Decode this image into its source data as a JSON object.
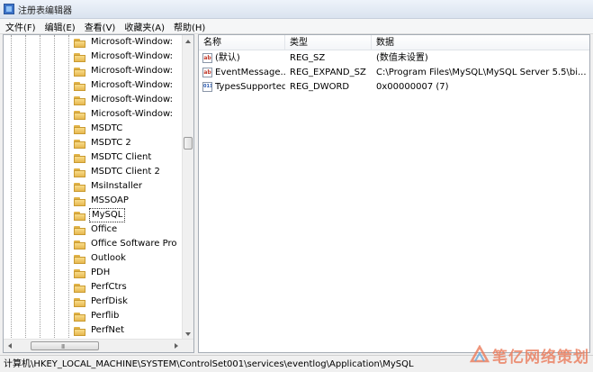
{
  "window": {
    "title": "注册表编辑器",
    "accent": "#3d74c9"
  },
  "menu": [
    "文件(F)",
    "编辑(E)",
    "查看(V)",
    "收藏夹(A)",
    "帮助(H)"
  ],
  "tree": {
    "items": [
      {
        "label": "Microsoft-Window:",
        "icon": "folder-icon"
      },
      {
        "label": "Microsoft-Window:",
        "icon": "folder-icon"
      },
      {
        "label": "Microsoft-Window:",
        "icon": "folder-icon"
      },
      {
        "label": "Microsoft-Window:",
        "icon": "folder-icon"
      },
      {
        "label": "Microsoft-Window:",
        "icon": "folder-icon"
      },
      {
        "label": "Microsoft-Window:",
        "icon": "folder-icon"
      },
      {
        "label": "MSDTC",
        "icon": "folder-icon"
      },
      {
        "label": "MSDTC 2",
        "icon": "folder-icon"
      },
      {
        "label": "MSDTC Client",
        "icon": "folder-icon"
      },
      {
        "label": "MSDTC Client 2",
        "icon": "folder-icon"
      },
      {
        "label": "MsiInstaller",
        "icon": "folder-icon"
      },
      {
        "label": "MSSOAP",
        "icon": "folder-icon"
      },
      {
        "label": "MySQL",
        "icon": "folder-icon",
        "selected": true
      },
      {
        "label": "Office",
        "icon": "folder-icon",
        "expandable": true
      },
      {
        "label": "Office Software Pro",
        "icon": "folder-icon"
      },
      {
        "label": "Outlook",
        "icon": "folder-icon"
      },
      {
        "label": "PDH",
        "icon": "folder-icon"
      },
      {
        "label": "PerfCtrs",
        "icon": "folder-icon"
      },
      {
        "label": "PerfDisk",
        "icon": "folder-icon"
      },
      {
        "label": "Perflib",
        "icon": "folder-icon"
      },
      {
        "label": "PerfNet",
        "icon": "folder-icon"
      }
    ],
    "hscroll_grip": "III"
  },
  "list": {
    "columns": [
      "名称",
      "类型",
      "数据"
    ],
    "rows": [
      {
        "icon": "string-value-icon",
        "icon_text": "ab",
        "name": "(默认)",
        "type": "REG_SZ",
        "data": "(数值未设置)"
      },
      {
        "icon": "string-value-icon",
        "icon_text": "ab",
        "name": "EventMessage...",
        "type": "REG_EXPAND_SZ",
        "data": "C:\\Program Files\\MySQL\\MySQL Server 5.5\\bi..."
      },
      {
        "icon": "binary-value-icon",
        "icon_text": "011",
        "name": "TypesSupported",
        "type": "REG_DWORD",
        "data": "0x00000007 (7)"
      }
    ]
  },
  "status": {
    "path": "计算机\\HKEY_LOCAL_MACHINE\\SYSTEM\\ControlSet001\\services\\eventlog\\Application\\MySQL"
  },
  "watermark": {
    "text": "笔亿网络策划",
    "color": "#ea7a5a"
  }
}
